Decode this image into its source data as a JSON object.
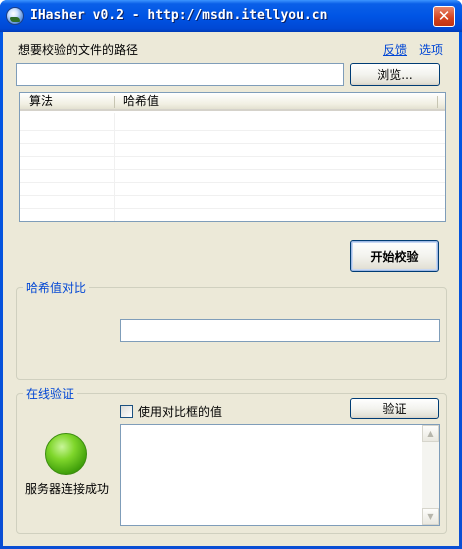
{
  "window": {
    "title": "IHasher v0.2 - http://msdn.itellyou.cn",
    "close_glyph": "✕",
    "icon": "globe-icon"
  },
  "file": {
    "label": "想要校验的文件的路径",
    "path_value": "",
    "browse_button": "浏览..."
  },
  "links": {
    "feedback": "反馈",
    "options": "选项"
  },
  "hash_table": {
    "columns": [
      "算法",
      "哈希值"
    ],
    "rows": []
  },
  "start_button": "开始校验",
  "compare": {
    "group_title": "哈希值对比",
    "value": ""
  },
  "online": {
    "group_title": "在线验证",
    "use_compare_label": "使用对比框的值",
    "use_compare_checked": false,
    "verify_button": "验证",
    "status_text": "服务器连接成功",
    "status_color": "#5cbf14",
    "result_text": ""
  },
  "colors": {
    "titlebar": "#0055e5",
    "client_bg": "#ece9d8",
    "link": "#0046d5",
    "close_button": "#d3411d"
  }
}
